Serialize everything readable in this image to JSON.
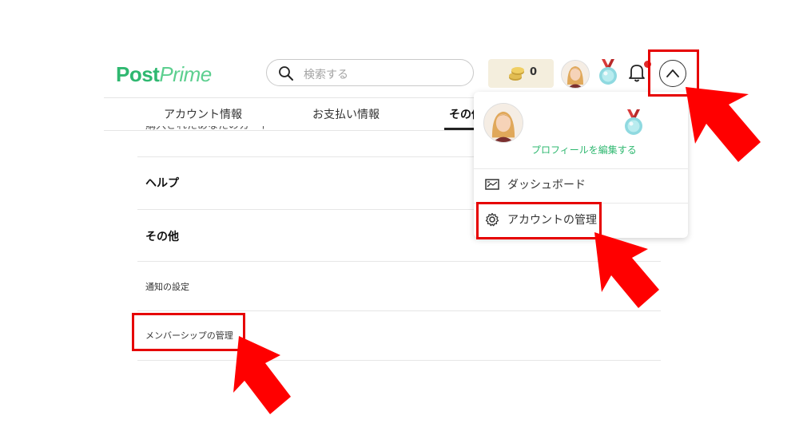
{
  "header": {
    "logo_part1": "Post",
    "logo_part2": "Prime",
    "search_placeholder": "検索する",
    "coin_count": "0"
  },
  "tabs": [
    {
      "label": "アカウント情報"
    },
    {
      "label": "お支払い情報"
    },
    {
      "label": "その他"
    }
  ],
  "list": {
    "cut_off_item": "購入されたあなたのカード",
    "help": "ヘルプ",
    "other": "その他",
    "notification_settings": "通知の設定",
    "membership_management": "メンバーシップの管理"
  },
  "dropdown": {
    "edit_profile": "プロフィールを編集する",
    "dashboard": "ダッシュボード",
    "account_management": "アカウントの管理"
  },
  "colors": {
    "brand_green": "#2fb870",
    "highlight_red": "#e60000"
  },
  "icons": [
    "search-icon",
    "coin-icon",
    "medal-icon",
    "bell-icon",
    "chevron-up-icon",
    "dashboard-icon",
    "gear-icon"
  ]
}
